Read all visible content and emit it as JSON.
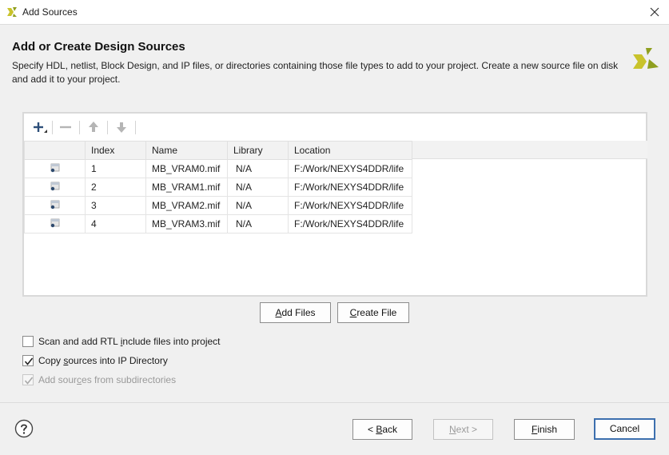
{
  "window": {
    "title": "Add Sources",
    "app_icon": "vivado-logo-icon",
    "close_icon": "close-icon"
  },
  "header": {
    "title": "Add or Create Design Sources",
    "description": "Specify HDL, netlist, Block Design, and IP files, or directories containing those file types to add to your project. Create a new source file on disk and add it to your project.",
    "logo_icon": "vivado-logo-icon"
  },
  "toolbar": {
    "add_icon": "plus-icon",
    "remove_icon": "minus-icon",
    "up_icon": "arrow-up-icon",
    "down_icon": "arrow-down-icon"
  },
  "table": {
    "columns": [
      "",
      "Index",
      "Name",
      "Library",
      "Location"
    ],
    "rows": [
      {
        "icon": "file-icon",
        "index": "1",
        "name": "MB_VRAM0.mif",
        "library": "N/A",
        "location": "F:/Work/NEXYS4DDR/life"
      },
      {
        "icon": "file-icon",
        "index": "2",
        "name": "MB_VRAM1.mif",
        "library": "N/A",
        "location": "F:/Work/NEXYS4DDR/life"
      },
      {
        "icon": "file-icon",
        "index": "3",
        "name": "MB_VRAM2.mif",
        "library": "N/A",
        "location": "F:/Work/NEXYS4DDR/life"
      },
      {
        "icon": "file-icon",
        "index": "4",
        "name": "MB_VRAM3.mif",
        "library": "N/A",
        "location": "F:/Work/NEXYS4DDR/life"
      }
    ]
  },
  "actions": {
    "add_files": {
      "pre": "",
      "mnemonic": "A",
      "post": "dd Files"
    },
    "create_file": {
      "pre": "",
      "mnemonic": "C",
      "post": "reate File"
    }
  },
  "options": {
    "scan_rtl": {
      "pre": "Scan and add RTL ",
      "mnemonic": "i",
      "post": "nclude files into project",
      "checked": false,
      "enabled": true
    },
    "copy_sources": {
      "pre": "Copy ",
      "mnemonic": "s",
      "post": "ources into IP Directory",
      "checked": true,
      "enabled": true
    },
    "add_subdirs": {
      "pre": "Add sour",
      "mnemonic": "c",
      "post": "es from subdirectories",
      "checked": true,
      "enabled": false
    }
  },
  "footer": {
    "help_icon": "help-icon",
    "back": {
      "pre": "< ",
      "mnemonic": "B",
      "post": "ack"
    },
    "next": {
      "pre": "",
      "mnemonic": "N",
      "post": "ext >"
    },
    "finish": {
      "pre": "",
      "mnemonic": "F",
      "post": "inish"
    },
    "cancel": {
      "pre": "Cancel",
      "mnemonic": "",
      "post": ""
    }
  },
  "colors": {
    "accent": "#3c6fae",
    "logo_yellow": "#c9c32b",
    "logo_green": "#8f9f1f"
  }
}
